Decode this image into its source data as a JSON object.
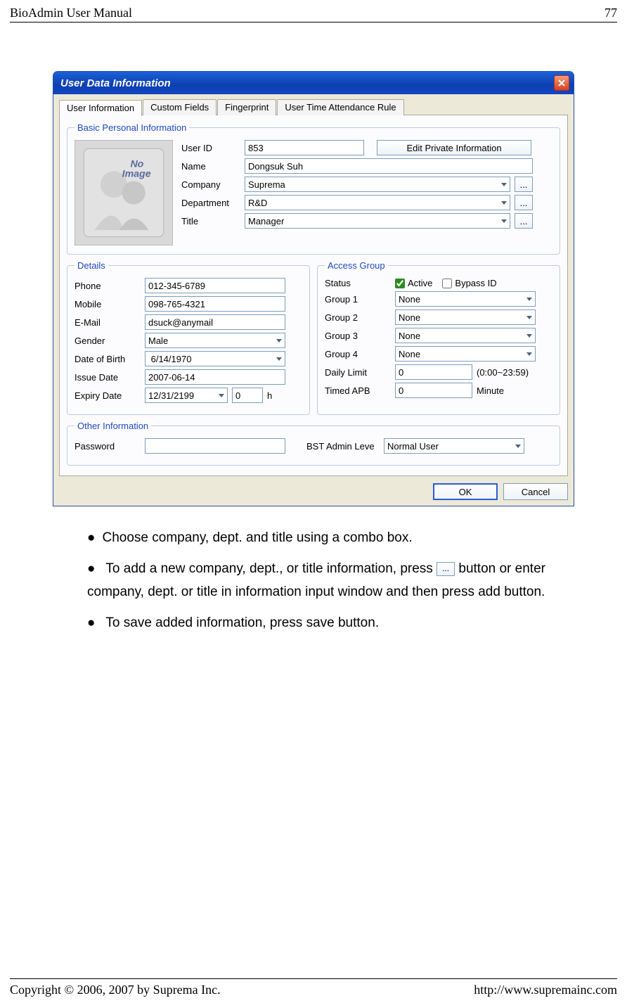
{
  "page": {
    "header_left": "BioAdmin User Manual",
    "header_right": "77",
    "footer_left": "Copyright © 2006, 2007 by Suprema Inc.",
    "footer_right": "http://www.supremainc.com"
  },
  "dialog": {
    "title": "User Data Information",
    "tabs": [
      "User Information",
      "Custom Fields",
      "Fingerprint",
      "User Time Attendance Rule"
    ],
    "active_tab": 0,
    "photo_placeholder": "No Image",
    "groups": {
      "basic": {
        "legend": "Basic Personal Information",
        "user_id_label": "User ID",
        "user_id": "853",
        "edit_private_btn": "Edit Private Information",
        "name_label": "Name",
        "name": "Dongsuk Suh",
        "company_label": "Company",
        "company": "Suprema",
        "department_label": "Department",
        "department": "R&D",
        "title_label": "Title",
        "title": "Manager"
      },
      "details": {
        "legend": "Details",
        "phone_label": "Phone",
        "phone": "012-345-6789",
        "mobile_label": "Mobile",
        "mobile": "098-765-4321",
        "email_label": "E-Mail",
        "email": "dsuck@anymail",
        "gender_label": "Gender",
        "gender": "Male",
        "dob_label": "Date of Birth",
        "dob": " 6/14/1970",
        "issue_label": "Issue Date",
        "issue": "2007-06-14",
        "expiry_label": "Expiry Date",
        "expiry": "12/31/2199",
        "expiry_extra": "0",
        "expiry_unit": "h"
      },
      "access": {
        "legend": "Access Group",
        "status_label": "Status",
        "active_label": "Active",
        "bypass_label": "Bypass ID",
        "group1_label": "Group 1",
        "group1": "None",
        "group2_label": "Group 2",
        "group2": "None",
        "group3_label": "Group 3",
        "group3": "None",
        "group4_label": "Group 4",
        "group4": "None",
        "daily_label": "Daily Limit",
        "daily": "0",
        "daily_hint": "(0:00~23:59)",
        "apb_label": "Timed APB",
        "apb": "0",
        "apb_unit": "Minute"
      },
      "other": {
        "legend": "Other Information",
        "password_label": "Password",
        "password": "",
        "admin_label": "BST Admin Leve",
        "admin": "Normal User"
      }
    },
    "ok": "OK",
    "cancel": "Cancel"
  },
  "bullets": {
    "b1": "Choose company, dept. and title using a combo box.",
    "b2a": "To add a new company, dept., or title information, press ",
    "b2b": " button or enter company, dept. or title in information input window and then press add button.",
    "b3": " To save added information, press save button."
  }
}
